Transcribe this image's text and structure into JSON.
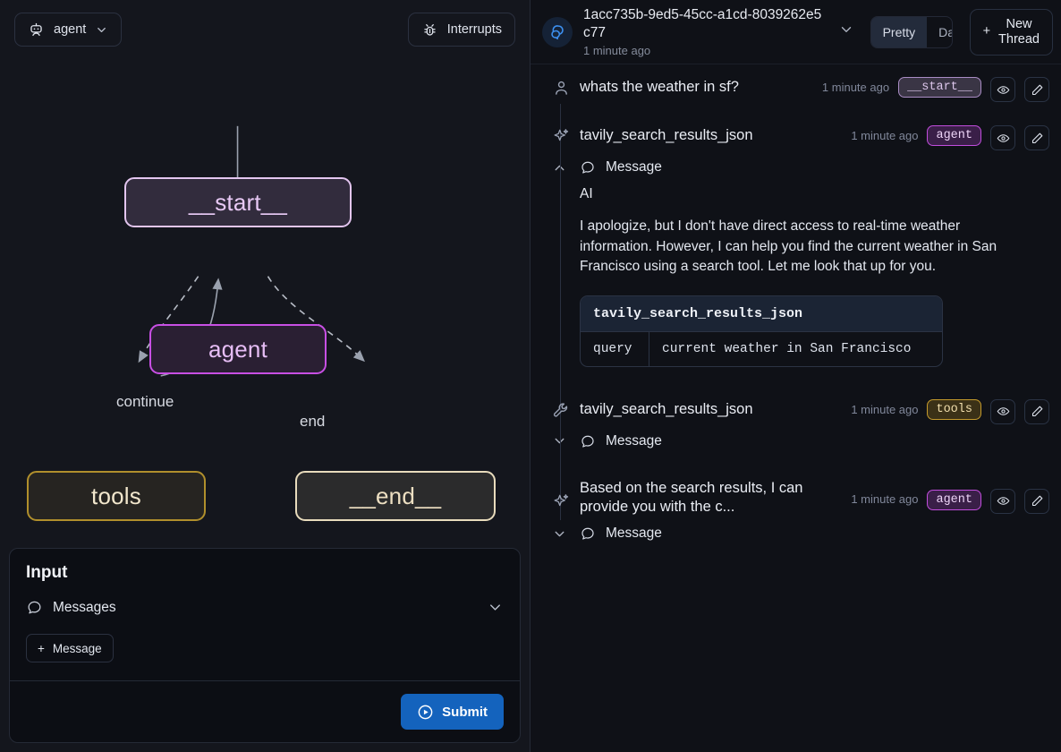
{
  "left": {
    "assistant_selector": {
      "label": "agent",
      "icon": "robot-icon",
      "chevron": "chevron-down-icon"
    },
    "interrupts_button": {
      "label": "Interrupts",
      "icon": "bug-icon"
    },
    "graph": {
      "nodes": [
        {
          "id": "start",
          "label": "__start__"
        },
        {
          "id": "agent",
          "label": "agent"
        },
        {
          "id": "tools",
          "label": "tools"
        },
        {
          "id": "end",
          "label": "__end__"
        }
      ],
      "edge_labels": {
        "continue": "continue",
        "end": "end"
      },
      "colors": {
        "start_border": "#e3c5ef",
        "agent_border": "#c84fe4",
        "tools_border": "#b08f2c",
        "end_border": "#e8dbbc"
      }
    },
    "input": {
      "title": "Input",
      "messages_label": "Messages",
      "messages_chevron": "chevron-down-icon",
      "add_message_label": "Message",
      "add_message_plus": "+",
      "submit_label": "Submit"
    }
  },
  "right": {
    "header": {
      "thread_id": "1acc735b-9ed5-45cc-a1cd-8039262e5c77",
      "timestamp": "1 minute ago",
      "chevron": "chevron-down-icon",
      "view_toggle": {
        "options": [
          "Pretty",
          "Data"
        ],
        "selected": "Pretty"
      },
      "new_thread": {
        "plus": "+",
        "line1": "New",
        "line2": "Thread"
      }
    },
    "messages": [
      {
        "icon": "user-icon",
        "title": "whats the weather in sf?",
        "time": "1 minute ago",
        "badge": "__start__",
        "badge_kind": "start",
        "eye": "eye-icon",
        "edit": "pencil-icon"
      },
      {
        "icon": "sparkle-icon",
        "title": "tavily_search_results_json",
        "time": "1 minute ago",
        "badge": "agent",
        "badge_kind": "agent",
        "eye": "eye-icon",
        "edit": "pencil-icon",
        "collapse_label": "Message",
        "collapse_state": "expanded",
        "role_label": "AI",
        "body": "I apologize, but I don't have direct access to real-time weather information. However, I can help you find the current weather in San Francisco using a search tool. Let me look that up for you.",
        "tool_call": {
          "name": "tavily_search_results_json",
          "arg_key": "query",
          "arg_value": "current weather in San Francisco"
        }
      },
      {
        "icon": "wrench-icon",
        "title": "tavily_search_results_json",
        "time": "1 minute ago",
        "badge": "tools",
        "badge_kind": "tools",
        "eye": "eye-icon",
        "edit": "pencil-icon",
        "collapse_label": "Message",
        "collapse_state": "collapsed"
      },
      {
        "icon": "sparkle-icon",
        "title": "Based on the search results, I can provide you with the c...",
        "time": "1 minute ago",
        "badge": "agent",
        "badge_kind": "agent",
        "eye": "eye-icon",
        "edit": "pencil-icon",
        "collapse_label": "Message",
        "collapse_state": "collapsed"
      }
    ]
  }
}
